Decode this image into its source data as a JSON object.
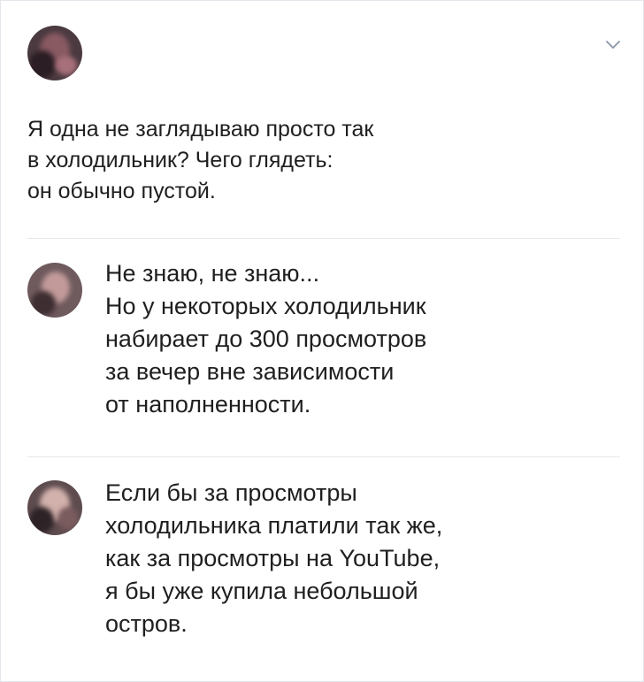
{
  "post": {
    "author_name": "",
    "author_meta": "",
    "text": "Я одна не заглядываю просто так\nв холодильник? Чего глядеть:\nон обычно пустой."
  },
  "icons": {
    "menu": "chevron-down-icon"
  },
  "comments": [
    {
      "text": "Не знаю, не знаю...\nНо у некоторых холодильник\nнабирает до 300 просмотров\nза вечер вне зависимости\nот наполненности."
    },
    {
      "text": "Если бы за просмотры\nхолодильника платили так же,\nкак за просмотры на YouTube,\nя бы уже купила небольшой\nостров."
    }
  ],
  "colors": {
    "text": "#1f1f1f",
    "divider": "#e7e8ec",
    "icon": "#8a96a8"
  }
}
